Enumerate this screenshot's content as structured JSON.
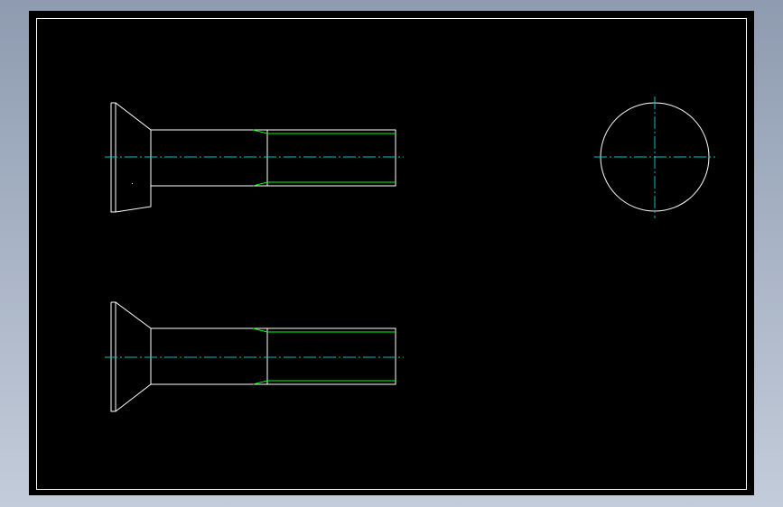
{
  "colors": {
    "background": "#000000",
    "outline": "#ffffff",
    "thread": "#00ff00",
    "centerline": "#00c0c0"
  },
  "views": [
    {
      "name": "screw-side-view-upper",
      "kind": "countersunk-screw-side-view"
    },
    {
      "name": "screw-side-view-lower",
      "kind": "countersunk-screw-side-view"
    },
    {
      "name": "screw-end-view",
      "kind": "circle-with-centerlines"
    }
  ]
}
